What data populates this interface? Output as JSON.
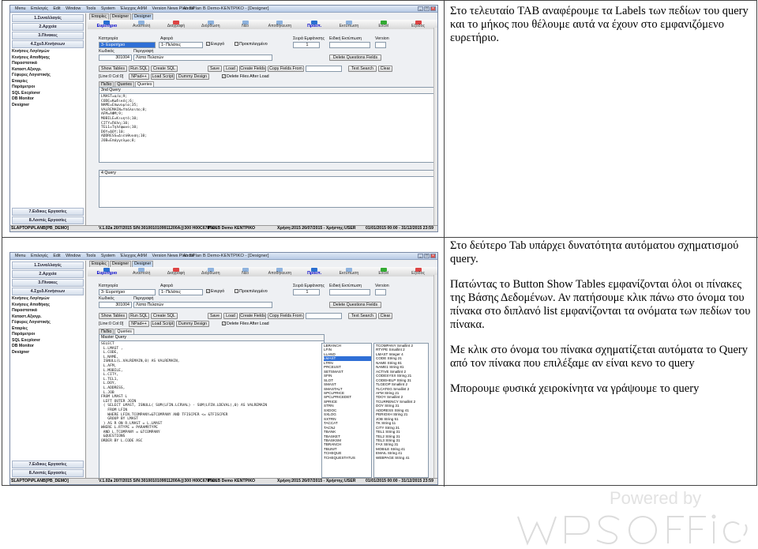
{
  "cells": [
    {
      "paragraphs": [
        "Στο τελευταίο TAB αναφέρουμε τα Labels των πεδίων του query και το μήκος που θέλουμε αυτά να έχουν στο εμφανιζόμενο ευρετήριο."
      ]
    },
    {
      "paragraphs": [
        "Στο δεύτερο Tab υπάρχει δυνατότητα αυτόματου σχηματισμού query.",
        "Πατώντας το Button Show Tables εμφανίζονται όλοι οι πίνακες της Βάσης Δεδομένων. Αν πατήσουμε κλικ πάνω στο όνομα του πίνακα στο διπλανό list εμφανίζονται τα ονόματα των πεδίων του πίνακα.",
        "Με κλικ στο όνομα του πίνακα σχηματίζεται αυτόματα το Query από τον πίνακα που επιλέξαμε αν είναι κενο το query",
        "Μπορουμε φυσικά χειροκίνητα να γράψουμε το query"
      ]
    }
  ],
  "app": {
    "title": "Plan BPlan B Demo-ΚΕΝΤΡΙΚΟ - [Designer]",
    "menu": [
      "Menu",
      "Επιλογές",
      "Edit",
      "Window",
      "Tools",
      "System",
      "Έλεγχος ΑΦΜ",
      "Version News",
      "About"
    ],
    "tabs": [
      "Εταιρίες",
      "Designer",
      "Designer"
    ],
    "toolbar": [
      "Ευρετήριο",
      "Αναστολή",
      "Διαγραφή",
      "Διόρθωση",
      "Νέο",
      "Αποθήκευση",
      "Προεπ.",
      "Εκτύπωση",
      "Excel",
      "Εξοδος"
    ],
    "sidebar_groups": [
      "1.Συναλλαγές",
      "2.Αρχεία",
      "3.Πίνακες",
      "4.Σχεδ.Κινήσεων"
    ],
    "sidebar_items": [
      "Κινήσεις Λογ/σμών",
      "Κινήσεις Αποθήκης",
      "Παραστατικά",
      "Καταστ.Αξιογρ.",
      "Γέφυρες Λογιστικής",
      "Εταιρίες",
      "Παράμετροι",
      "SQL Excplorer",
      "DB Monitor",
      "Designer"
    ],
    "sidebar_footer": [
      "7.Ειδικες Εργασίες",
      "8.Λοιπές Εργασίες"
    ],
    "form": {
      "category_label": "Κατηγορία",
      "category_value": "3- Ευρετήριο",
      "refers_label": "Αφορά",
      "refers_value": "1- Πελάτες",
      "active_label": "Ενεργό",
      "active_check": "✓",
      "default_label": "Προεπιλεγμένο",
      "order_label": "Σειρά Εμφάνισης",
      "order_value": "1",
      "special_label": "Ειδική Εκτύπωση",
      "version_label": "Version",
      "code_label": "Κωδικός",
      "code_value": "301004",
      "desc_label": "Περιγραφή",
      "desc_value": "Λίστα Πελατών",
      "delete_btn": "Delete Questions Fields",
      "buttons": [
        "Show Tables",
        "Run SQL",
        "Create SQL",
        "Save",
        "Load",
        "Create Fields",
        "Copy Fields From",
        "Text Search",
        "Clear"
      ],
      "line_col": "[Line:0 Col:0]",
      "npad": "NPad++",
      "load_script": "Load Script",
      "dummy": "Dummy Design",
      "delete_filter": "Delete Files After Load",
      "delete_filter_check": "✓",
      "subtabs": [
        "Πεδία",
        "Queries",
        "Queries"
      ]
    },
    "status": [
      "SLAPTOP\\PLANB[PB_DEMO]",
      "V.1.02a 20/7/2015 S/N:3010010109911200A@300 H00C678TC1",
      "Plan B Demo ΚΕΝΤΡΙΚΟ",
      "Χρήση:2015 26/07/2015 - Χρήστης:USER",
      "01/01/2015 00:00 - 31/12/2015 23:59"
    ]
  },
  "shot1": {
    "query_head": "3nd Query",
    "query_lines": [
      "LMAST=α/α;9;",
      "CODE=Κωδικός;6;",
      "NAME=Επωνυμία;35;",
      "VALREMAIN=Υπόλοιπο;8;",
      "AFM=ΑΦΜ;9;",
      "MOBILE=Κινητό;10;",
      "CITY=Πόλη;10;",
      "TEL1=Τηλέφωνο;10;",
      "DOY=ΔΟΥ;10;",
      "ADDRESS=Διεύθυνση;10;",
      "JOB=Επάγγελμα;8;"
    ],
    "query4_head": "4 Query"
  },
  "shot2": {
    "master_head": "Master Query",
    "query_lines": [
      "SELECT",
      " L.LMAST ,",
      " L.CODE,",
      " L.NAME,",
      " ISNULL(L.VALREMAIN,0) AS VALREMAIN,",
      " L.AFM,",
      " L.MOBILE,",
      " L.CITY,",
      " L.TEL1,",
      " L.DOY,",
      " L.ADDRESS,",
      " L.JOB",
      "FROM LMAST L",
      " LEFT OUTER JOIN",
      " ( SELECT LMAST, ISNULL( SUM(LFIN.LCRVAL) - SUM(LFIN.LDEVAL),0) AS VALREMAIN",
      "   FROM LFIN",
      "   WHERE LFIN.TCOMPANY=&TCOMPANY AND TFISCPER <= &TFISCPER",
      "   GROUP BY LMAST",
      " ) AS R ON R.LMAST = L.LMAST",
      "WHERE L.RTYPE = PARAMRTYPE",
      " AND L.TCOMPANY = &TCOMPANY",
      " &QUESTIONS",
      "ORDER BY L.CODE ASC"
    ],
    "tables": [
      "LBRANCH",
      "LFIN",
      "LLAND",
      "LMAST",
      "LTRN",
      "PRCEUST",
      "SETSMAST",
      "SFIN",
      "SLOT",
      "SMAST",
      "SMASTALT",
      "SPCLPRICE",
      "SPCLPRICEDET",
      "SPRICE",
      "STRN",
      "SXDOC",
      "SXLOG",
      "SXTRN",
      "TACCAT",
      "TACNJ",
      "TBANK",
      "TBASKET",
      "TBASKSM",
      "TBRANCH",
      "TBUNIT",
      "TCHEQUE",
      "TCHEQUESTATUS"
    ],
    "tables_selected": 3,
    "fields": [
      "TCOMPANY Smallint 2",
      "RTYPE Smallint 2",
      "LMAST Integer 4",
      "CODE String 21",
      "NAME String 81",
      "NAME1 String 81",
      "ACTIVE Smallint 2",
      "CODESYSX String 21",
      "CODEHELP String 31",
      "TLGEOP Smallint 2",
      "TLCATEG Smallint 2",
      "AFM String 21",
      "TDOY Smallint 2",
      "TCURRENCY Smallint 2",
      "DOY String 31",
      "ADDRESS String 41",
      "PERIOXH String 21",
      "JOB String 51",
      "TK String 11",
      "CITY String 31",
      "TEL1 String 31",
      "TEL2 String 31",
      "TEL3 String 31",
      "FAX String 31",
      "MOBILE String 41",
      "EMAIL String 41",
      "WEBPAGE String 41"
    ]
  }
}
